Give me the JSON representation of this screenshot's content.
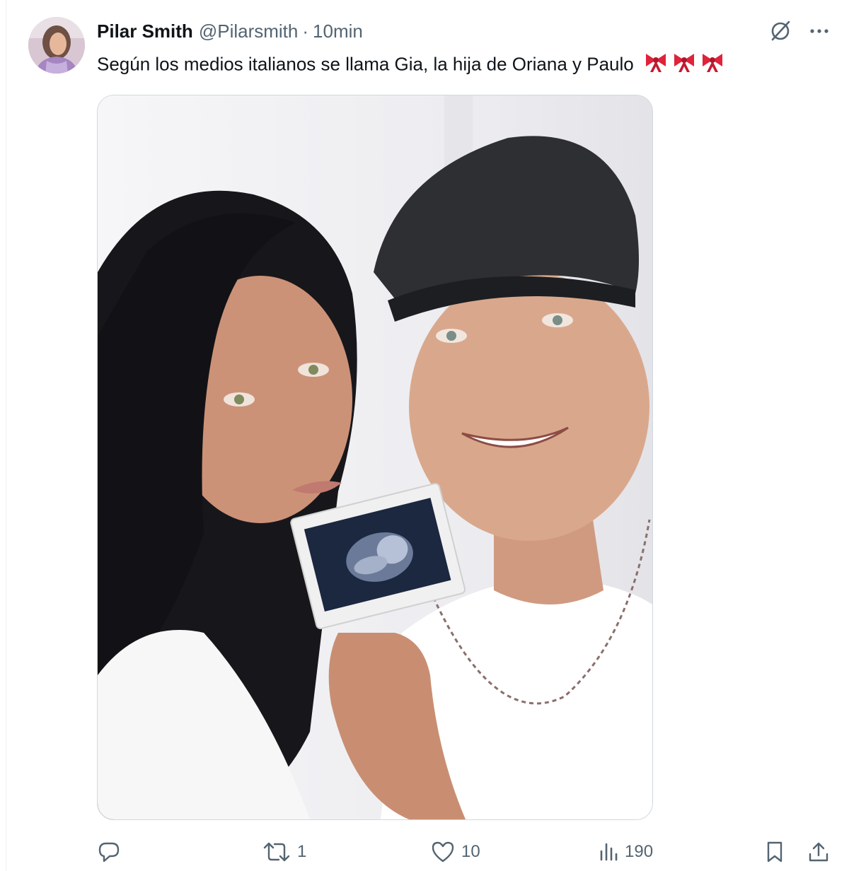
{
  "tweet": {
    "author": {
      "display_name": "Pilar Smith",
      "handle": "@Pilarsmith",
      "separator": "·",
      "time": "10min"
    },
    "text": "Según los medios italianos se llama Gia, la hija de Oriana y Paulo",
    "emoji": [
      "ribbon",
      "ribbon",
      "ribbon"
    ],
    "header_icons": [
      "grok-icon",
      "more-icon"
    ],
    "actions": {
      "reply": {
        "icon": "reply-icon",
        "count": ""
      },
      "retweet": {
        "icon": "retweet-icon",
        "count": "1"
      },
      "like": {
        "icon": "heart-icon",
        "count": "10"
      },
      "views": {
        "icon": "views-icon",
        "count": "190"
      },
      "bookmark": {
        "icon": "bookmark-icon"
      },
      "share": {
        "icon": "share-icon"
      }
    }
  },
  "colors": {
    "primary_text": "#0f1419",
    "secondary_text": "#536471",
    "border": "#cfd9de",
    "ribbon": "#e0223a"
  }
}
